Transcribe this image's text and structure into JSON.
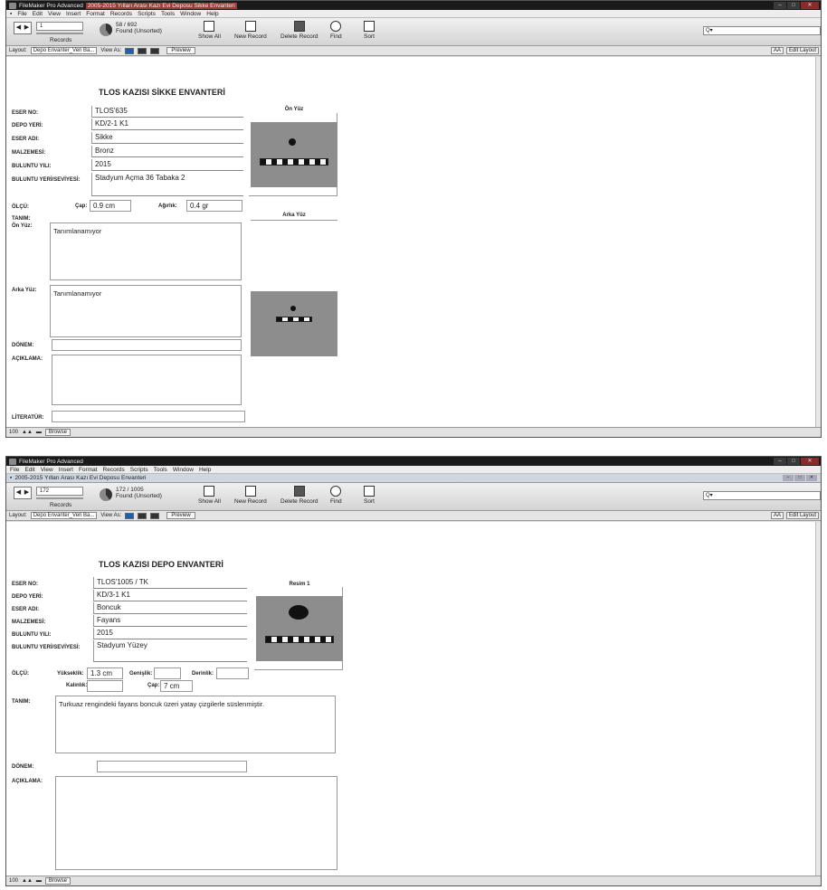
{
  "top_window": {
    "app_title": "FileMaker Pro Advanced",
    "doc_title": "2005-2015 Yılları Arası Kazı Evi Deposu Sikke Envanteri",
    "menu": [
      "File",
      "Edit",
      "View",
      "Insert",
      "Format",
      "Records",
      "Scripts",
      "Tools",
      "Window",
      "Help"
    ],
    "toolbar": {
      "record_number": "1",
      "records_label": "Records",
      "found_count": "58 / 692",
      "found_status": "Found (Unsorted)",
      "show_all": "Show All",
      "new_record": "New Record",
      "delete_record": "Delete Record",
      "find": "Find",
      "sort": "Sort",
      "search_placeholder": "Q▾"
    },
    "layout_bar": {
      "layout_label": "Layout:",
      "layout_value": "Depo Envanter_Veri Ba...",
      "view_as_label": "View As:",
      "preview": "Preview",
      "aa": "AA",
      "edit_layout": "Edit Layout"
    },
    "form": {
      "title": "TLOS KAZISI SİKKE ENVANTERİ",
      "labels": {
        "eser_no": "ESER NO:",
        "depo_yeri": "DEPO YERİ:",
        "eser_adi": "ESER ADI:",
        "malzemesi": "MALZEMESİ:",
        "buluntu_yili": "BULUNTU YILI:",
        "buluntu_yeri": "BULUNTU YERİ/SEVİYESİ:",
        "olcu": "ÖLÇÜ:",
        "cap": "Çap:",
        "agirlik": "Ağırlık:",
        "tanim": "TANIM:",
        "on_yuz": "Ön Yüz:",
        "arka_yuz": "Arka Yüz:",
        "donem": "DÖNEM:",
        "aciklama": "AÇIKLAMA:",
        "literatur": "LİTERATÜR:"
      },
      "values": {
        "eser_no": "TLOS'635",
        "depo_yeri": "KD/2-1 K1",
        "eser_adi": "Sikke",
        "malzemesi": "Bronz",
        "buluntu_yili": "2015",
        "buluntu_yeri": "Stadyum Açma 36 Tabaka 2",
        "cap": "0.9 cm",
        "agirlik": "0.4 gr",
        "on_yuz": "Tanımlanamıyor",
        "arka_yuz": "Tanımlanamıyor"
      },
      "image_captions": {
        "front": "Ön Yüz",
        "back": "Arka Yüz"
      }
    },
    "status": {
      "zoom": "100",
      "mode": "Browse"
    }
  },
  "bottom_window": {
    "app_title": "FileMaker Pro Advanced",
    "doc_title": "2005-2015 Yılları Arası Kazı Evi Deposu Envanteri",
    "menu": [
      "File",
      "Edit",
      "View",
      "Insert",
      "Format",
      "Records",
      "Scripts",
      "Tools",
      "Window",
      "Help"
    ],
    "toolbar": {
      "record_number": "172",
      "records_label": "Records",
      "found_count": "172 / 1005",
      "found_status": "Found (Unsorted)",
      "show_all": "Show All",
      "new_record": "New Record",
      "delete_record": "Delete Record",
      "find": "Find",
      "sort": "Sort",
      "search_placeholder": "Q▾"
    },
    "layout_bar": {
      "layout_label": "Layout:",
      "layout_value": "Depo Envanter_Veri Ba...",
      "view_as_label": "View As:",
      "preview": "Preview",
      "aa": "AA",
      "edit_layout": "Edit Layout"
    },
    "form": {
      "title": "TLOS KAZISI DEPO ENVANTERİ",
      "labels": {
        "eser_no": "ESER NO:",
        "depo_yeri": "DEPO YERİ:",
        "eser_adi": "ESER ADI:",
        "malzemesi": "MALZEMESİ:",
        "buluntu_yili": "BULUNTU YILI:",
        "buluntu_yeri": "BULUNTU YERİ/SEVİYESİ:",
        "olcu": "ÖLÇÜ:",
        "yukseklik": "Yükseklik:",
        "genislik": "Genişlik:",
        "derinlik": "Derinlik:",
        "kalinlik": "Kalınlık:",
        "cap": "Çap:",
        "tanim": "TANIM:",
        "donem": "DÖNEM:",
        "aciklama": "AÇIKLAMA:"
      },
      "values": {
        "eser_no": "TLOS'1005 / TK",
        "depo_yeri": "KD/3-1 K1",
        "eser_adi": "Boncuk",
        "malzemesi": "Fayans",
        "buluntu_yili": "2015",
        "buluntu_yeri": "Stadyum Yüzey",
        "yukseklik": "1.3 cm",
        "cap": "7 cm",
        "tanim": "Turkuaz rengindeki fayans boncuk üzeri yatay çizgilerle süslenmiştir."
      },
      "image_captions": {
        "front": "Resim 1"
      }
    },
    "status": {
      "zoom": "100",
      "mode": "Browse"
    }
  }
}
